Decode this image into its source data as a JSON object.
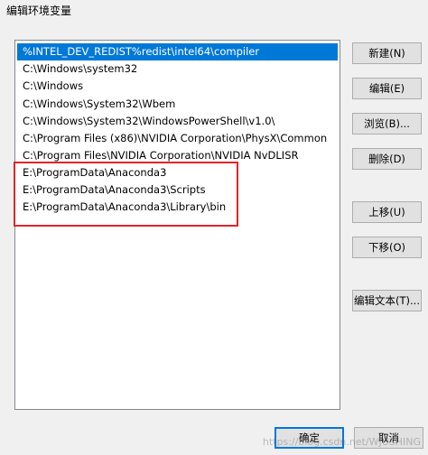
{
  "window": {
    "title": "编辑环境变量"
  },
  "list": {
    "items": [
      "%INTEL_DEV_REDIST%redist\\intel64\\compiler",
      "C:\\Windows\\system32",
      "C:\\Windows",
      "C:\\Windows\\System32\\Wbem",
      "C:\\Windows\\System32\\WindowsPowerShell\\v1.0\\",
      "C:\\Program Files (x86)\\NVIDIA Corporation\\PhysX\\Common",
      "C:\\Program Files\\NVIDIA Corporation\\NVIDIA NvDLISR",
      "E:\\ProgramData\\Anaconda3",
      "E:\\ProgramData\\Anaconda3\\Scripts",
      "E:\\ProgramData\\Anaconda3\\Library\\bin"
    ],
    "selected_index": 0
  },
  "buttons": {
    "new": "新建(N)",
    "edit": "编辑(E)",
    "browse": "浏览(B)...",
    "delete": "删除(D)",
    "move_up": "上移(U)",
    "move_down": "下移(O)",
    "edit_text": "编辑文本(T)...",
    "ok": "确定",
    "cancel": "取消"
  },
  "colors": {
    "selection": "#0078d7",
    "highlight_border": "#e0242a"
  },
  "watermark": "https://blog.csdn.net/WJUSHING"
}
